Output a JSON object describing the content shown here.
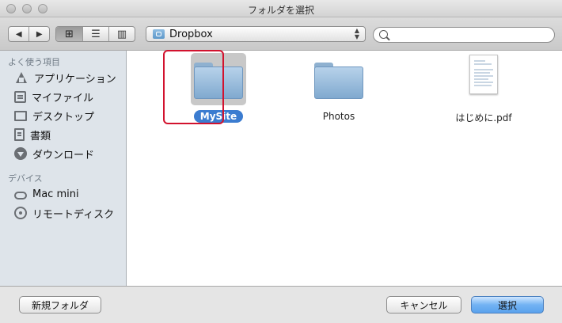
{
  "window": {
    "title": "フォルダを選択"
  },
  "toolbar": {
    "back_glyph": "◀",
    "forward_glyph": "▶",
    "view_icon_glyph": "⊞",
    "view_list_glyph": "☰",
    "view_column_glyph": "▥",
    "location_label": "Dropbox",
    "location_updown": "▲▼",
    "search_placeholder": ""
  },
  "sidebar": {
    "favorites_title": "よく使う項目",
    "favorites": [
      {
        "label": "アプリケーション",
        "icon": "applications-icon"
      },
      {
        "label": "マイファイル",
        "icon": "all-my-files-icon"
      },
      {
        "label": "デスクトップ",
        "icon": "desktop-icon"
      },
      {
        "label": "書類",
        "icon": "documents-icon"
      },
      {
        "label": "ダウンロード",
        "icon": "downloads-icon"
      }
    ],
    "devices_title": "デバイス",
    "devices": [
      {
        "label": "Mac mini",
        "icon": "mac-mini-icon"
      },
      {
        "label": "リモートディスク",
        "icon": "remote-disc-icon"
      }
    ]
  },
  "files": [
    {
      "name": "MySite",
      "kind": "folder",
      "selected": true
    },
    {
      "name": "Photos",
      "kind": "folder",
      "selected": false
    },
    {
      "name": "はじめに.pdf",
      "kind": "pdf",
      "selected": false
    }
  ],
  "buttons": {
    "new_folder": "新規フォルダ",
    "cancel": "キャンセル",
    "choose": "選択"
  },
  "colors": {
    "highlight_frame": "#d2122e",
    "selection_blue": "#3b7cd0",
    "primary_button": "#5aa2ed",
    "sidebar_bg": "#dee4ea"
  }
}
